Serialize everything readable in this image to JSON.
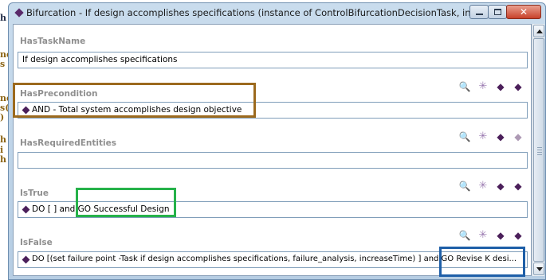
{
  "background_doc": {
    "fragments": [
      "h",
      "ne",
      "s",
      "ne",
      "s(",
      ")",
      "h",
      "i",
      "h"
    ]
  },
  "window": {
    "title": "Bifurcation - If design accomplishes specifications  (instance of ControlBifurcationDecisionTask, inte...",
    "icons": {
      "title": "diamond-icon",
      "minimize": "minimize-icon",
      "maximize": "maximize-icon",
      "close": "close-icon"
    },
    "close_glyph": "✕"
  },
  "slots": {
    "has_task_name": {
      "label": "HasTaskName",
      "value": "If design accomplishes specifications"
    },
    "has_precondition": {
      "label": "HasPrecondition",
      "value": "AND - Total system    accomplishes    design objective"
    },
    "has_required_entities": {
      "label": "HasRequiredEntities",
      "value": ""
    },
    "is_true": {
      "label": "IsTrue",
      "value": "DO [ ] and  GO Successful Design"
    },
    "is_false": {
      "label": "IsFalse",
      "value": "DO [(set failure point -Task if design accomplishes specifications, failure_analysis, increaseTime) ] and  GO Revise K desi..."
    }
  },
  "toolbar_glyphs": {
    "find": "🔍",
    "create": "✳",
    "add": "◆",
    "remove": "◆"
  },
  "annotations": {
    "brown": "#9c6a1e",
    "green": "#26b24a",
    "blue": "#1e5fa8"
  }
}
